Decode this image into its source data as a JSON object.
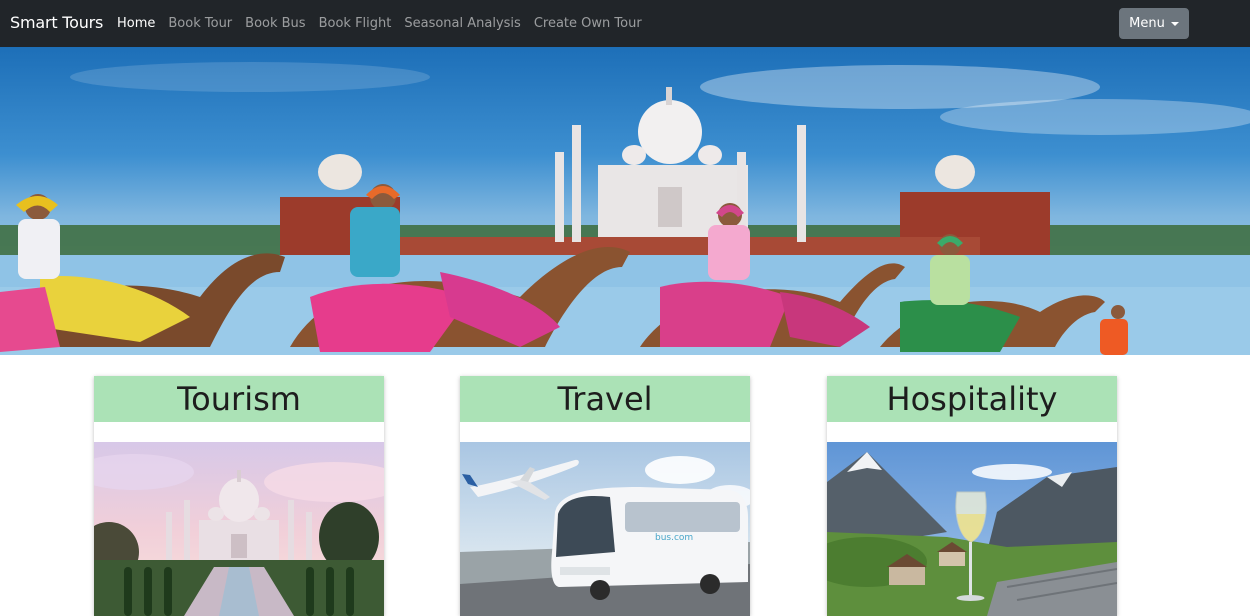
{
  "navbar": {
    "brand": "Smart Tours",
    "links": [
      {
        "label": "Home",
        "active": true
      },
      {
        "label": "Book Tour",
        "active": false
      },
      {
        "label": "Book Bus",
        "active": false
      },
      {
        "label": "Book Flight",
        "active": false
      },
      {
        "label": "Seasonal Analysis",
        "active": false
      },
      {
        "label": "Create Own Tour",
        "active": false
      }
    ],
    "menu_button": "Menu"
  },
  "cards": [
    {
      "title": "Tourism",
      "image": "taj-mahal-photo"
    },
    {
      "title": "Travel",
      "image": "plane-and-bus-photo"
    },
    {
      "title": "Hospitality",
      "image": "alpine-wine-photo"
    }
  ],
  "colors": {
    "navbar_bg": "#212529",
    "card_header_bg": "#abe2b6",
    "menu_button_bg": "#6c757d"
  }
}
